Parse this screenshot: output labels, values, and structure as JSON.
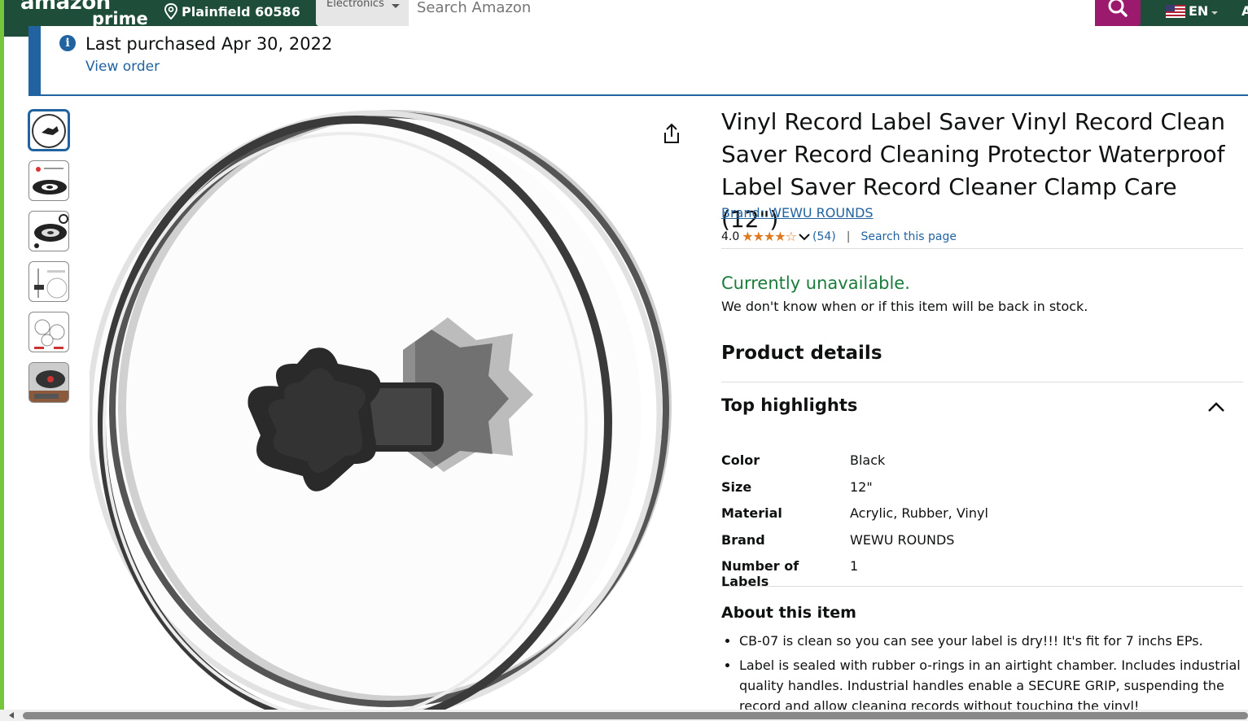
{
  "header": {
    "logo_text": "amazon",
    "logo_sub": "prime",
    "location": "Plainfield 60586",
    "category": "Electronics",
    "search_placeholder": "Search Amazon",
    "language": "EN",
    "account": "A"
  },
  "banner": {
    "message": "Last purchased Apr 30, 2022",
    "link": "View order"
  },
  "product": {
    "title": "Vinyl Record Label Saver Vinyl Record Clean Saver Record Cleaning Protector Waterproof Label Saver Record Cleaner Clamp Care (12\")",
    "brand": "Brand: WEWU ROUNDS",
    "rating": "4.0",
    "stars": "★★★★☆",
    "review_count": "(54)",
    "search_page": "Search this page",
    "availability": "Currently unavailable.",
    "stock_note": "We don't know when or if this item will be back in stock."
  },
  "details": {
    "heading": "Product details",
    "highlights_heading": "Top highlights",
    "specs": [
      {
        "key": "Color",
        "value": "Black"
      },
      {
        "key": "Size",
        "value": "12\""
      },
      {
        "key": "Material",
        "value": "Acrylic, Rubber, Vinyl"
      },
      {
        "key": "Brand",
        "value": "WEWU ROUNDS"
      },
      {
        "key": "Number of Labels",
        "value": "1"
      }
    ],
    "about_heading": "About this item",
    "bullets": [
      "CB-07 is clean so you can see your label is dry!!! It's fit for 7 inchs EPs.",
      "Label is sealed with rubber o-rings in an airtight chamber. Includes industrial quality handles. Industrial handles enable a SECURE GRIP, suspending the record and allow cleaning records without touching the vinyl!"
    ]
  },
  "colors": {
    "header_bg": "#1e4d3a",
    "search_button": "#9b1a6e",
    "link": "#2162a1",
    "available_green": "#1a7c3a",
    "star": "#de7921"
  }
}
